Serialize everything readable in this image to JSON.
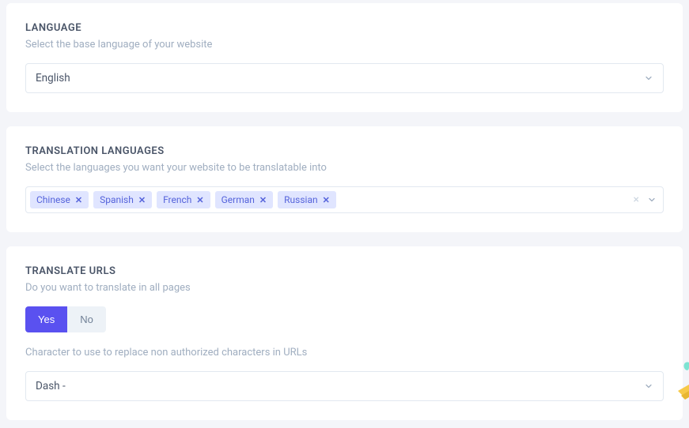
{
  "language": {
    "title": "LANGUAGE",
    "desc": "Select the base language of your website",
    "selected": "English"
  },
  "translation": {
    "title": "TRANSLATION LANGUAGES",
    "desc": "Select the languages you want your website to be translatable into",
    "tags": [
      "Chinese",
      "Spanish",
      "French",
      "German",
      "Russian"
    ]
  },
  "urls": {
    "title": "TRANSLATE URLS",
    "desc": "Do you want to translate in all pages",
    "toggle": {
      "yes": "Yes",
      "no": "No",
      "selected": "yes"
    },
    "replace_desc": "Character to use to replace non authorized characters in URLs",
    "selected_char": "Dash -"
  },
  "icons": {
    "chevron": "chevron-down",
    "clear": "×",
    "tag_remove": "✕"
  },
  "colors": {
    "accent": "#5a51f0",
    "tag_bg": "#e0e5ff",
    "tag_fg": "#5563db",
    "muted": "#a0aec0",
    "border": "#e2e8f0",
    "card_bg": "#ffffff",
    "page_bg": "#f4f5f9"
  }
}
